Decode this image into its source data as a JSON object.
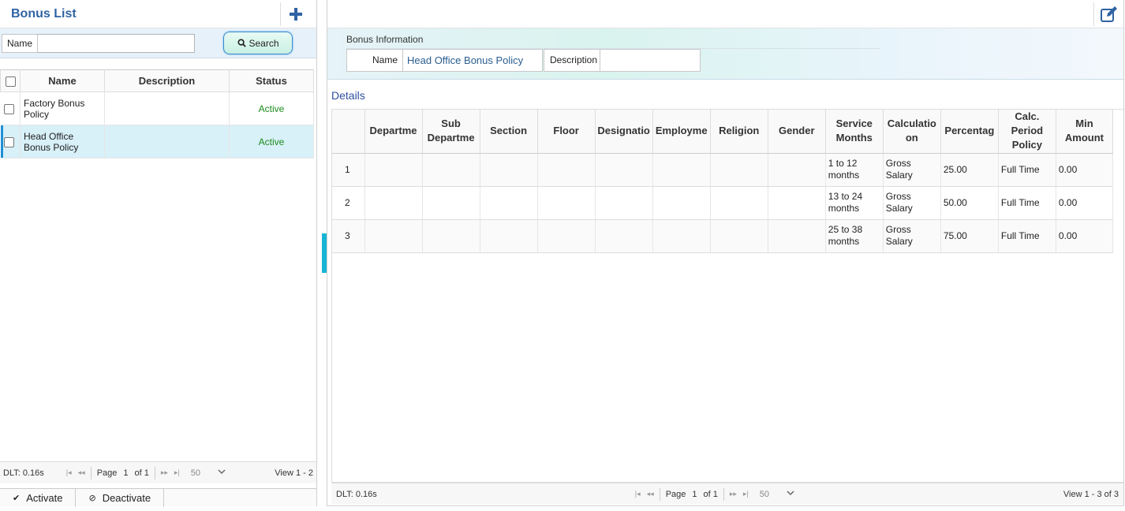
{
  "left": {
    "title": "Bonus List",
    "search": {
      "label": "Name",
      "value": "",
      "button": "Search"
    },
    "columns": [
      "Name",
      "Description",
      "Status"
    ],
    "rows": [
      {
        "name": "Factory Bonus Policy",
        "description": "",
        "status": "Active"
      },
      {
        "name": "Head Office Bonus Policy",
        "description": "",
        "status": "Active"
      }
    ],
    "footer": {
      "dlt": "DLT: 0.16s",
      "page_label": "Page",
      "page": "1",
      "of": "of 1",
      "rows": "50",
      "view": "View 1 - 2"
    },
    "actions": {
      "activate": "Activate",
      "deactivate": "Deactivate"
    }
  },
  "right": {
    "info_title": "Bonus Information",
    "name_label": "Name",
    "name_value": "Head Office Bonus Policy",
    "description_label": "Description",
    "description_value": "",
    "details_title": "Details",
    "columns": [
      "",
      "Departme",
      "Sub Departme",
      "Section",
      "Floor",
      "Designatio",
      "Employme",
      "Religion",
      "Gender",
      "Service Months",
      "Calculatio on",
      "Percentag",
      "Calc. Period Policy",
      "Min Amount"
    ],
    "rows": [
      {
        "idx": "1",
        "service": "1 to 12 months",
        "calc": "Gross Salary",
        "pct": "25.00",
        "period": "Full Time",
        "min": "0.00"
      },
      {
        "idx": "2",
        "service": "13 to 24 months",
        "calc": "Gross Salary",
        "pct": "50.00",
        "period": "Full Time",
        "min": "0.00"
      },
      {
        "idx": "3",
        "service": "25 to 38 months",
        "calc": "Gross Salary",
        "pct": "75.00",
        "period": "Full Time",
        "min": "0.00"
      }
    ],
    "footer": {
      "dlt": "DLT: 0.16s",
      "page_label": "Page",
      "page": "1",
      "of": "of 1",
      "rows": "50",
      "view": "View 1 - 3 of 3"
    }
  },
  "icons": {
    "add": "plus-icon",
    "edit": "edit-icon",
    "search": "search-icon",
    "check": "check-icon",
    "ban": "ban-icon"
  },
  "colors": {
    "accent": "#2f63a3",
    "active": "#1b8c1b",
    "selected": "#d8f0f8",
    "splitter": "#18b4d6"
  }
}
